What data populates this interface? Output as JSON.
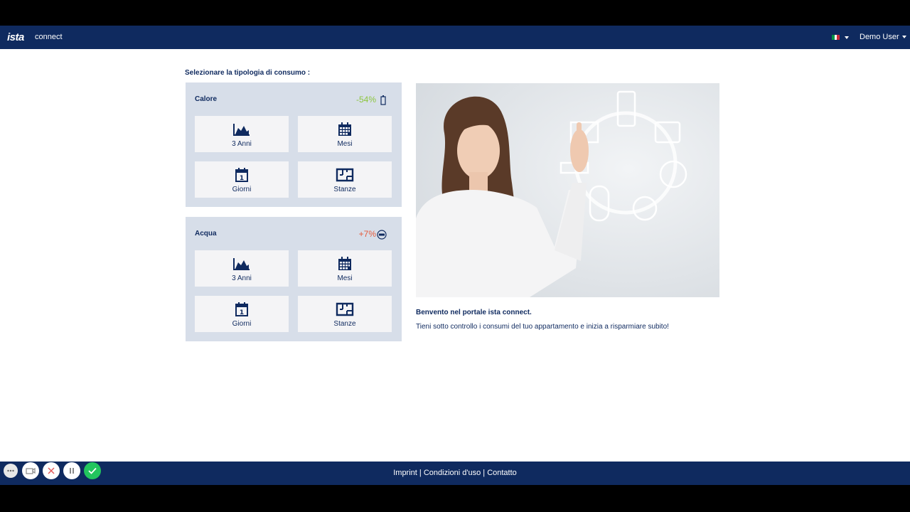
{
  "header": {
    "logo": "ista",
    "app_name": "connect",
    "language_flag": [
      "#009246",
      "#ffffff",
      "#ce2b37"
    ],
    "user_menu": "Demo User"
  },
  "main": {
    "section_title": "Selezionare la tipologia di consumo :",
    "panels": [
      {
        "title": "Calore",
        "change": "-54%",
        "change_color": "#8dc63f",
        "icon": "radiator-icon",
        "tiles": [
          {
            "label": "3 Anni",
            "icon": "area-chart-icon"
          },
          {
            "label": "Mesi",
            "icon": "calendar-grid-icon"
          },
          {
            "label": "Giorni",
            "icon": "calendar-day-icon"
          },
          {
            "label": "Stanze",
            "icon": "floor-plan-icon"
          }
        ]
      },
      {
        "title": "Acqua",
        "change": "+7%",
        "change_color": "#e55b3c",
        "icon": "water-meter-icon",
        "tiles": [
          {
            "label": "3 Anni",
            "icon": "area-chart-icon"
          },
          {
            "label": "Mesi",
            "icon": "calendar-grid-icon"
          },
          {
            "label": "Giorni",
            "icon": "calendar-day-icon"
          },
          {
            "label": "Stanze",
            "icon": "floor-plan-icon"
          }
        ]
      }
    ],
    "hero_image": "woman-touching-meter-icons",
    "welcome_title": "Benvento nel portale ista connect.",
    "welcome_text": "Tieni sotto controllo i consumi del tuo appartamento e inizia a risparmiare subito!"
  },
  "footer": {
    "links": [
      "Imprint",
      "Condizioni d'uso",
      "Contatto"
    ],
    "separator": " | "
  },
  "player_controls": [
    "more-icon",
    "camera-icon",
    "close-icon",
    "pause-icon",
    "check-icon"
  ]
}
